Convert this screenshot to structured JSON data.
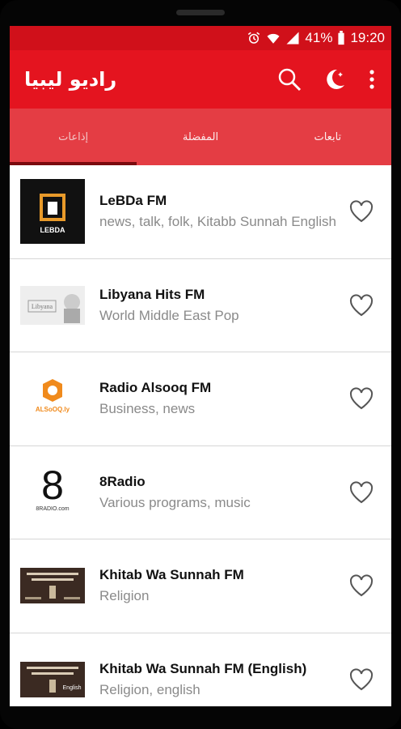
{
  "status": {
    "battery": "41%",
    "time": "19:20"
  },
  "app": {
    "title": "راديو ليبيا"
  },
  "icons": {
    "search": "search-icon",
    "night": "moon-star-icon",
    "menu": "more-vert-icon",
    "favorite": "heart-outline-icon"
  },
  "tabs": [
    {
      "label": "إذاعات"
    },
    {
      "label": "المفضلة"
    },
    {
      "label": "تابعات"
    }
  ],
  "stations": [
    {
      "name": "LeBDa FM",
      "desc": "news, talk, folk, Kitabb Sunnah English",
      "logo_text": "LEBDA"
    },
    {
      "name": "Libyana Hits FM",
      "desc": "World Middle East Pop",
      "logo_text": "Libyana"
    },
    {
      "name": "Radio Alsooq FM",
      "desc": "Business, news",
      "logo_text": "ALSoOQ.ly"
    },
    {
      "name": "8Radio",
      "desc": "Various programs, music",
      "logo_text": "8",
      "logo_sub": "8RADIO.com"
    },
    {
      "name": "Khitab Wa Sunnah FM",
      "desc": "Religion",
      "logo_text": ""
    },
    {
      "name": "Khitab Wa Sunnah FM (English)",
      "desc": "Religion, english",
      "logo_text": "English"
    }
  ],
  "colors": {
    "status": "#d0101a",
    "appbar": "#e4141f",
    "tabs": "#e43d44",
    "indicator": "#7a0a0e"
  }
}
